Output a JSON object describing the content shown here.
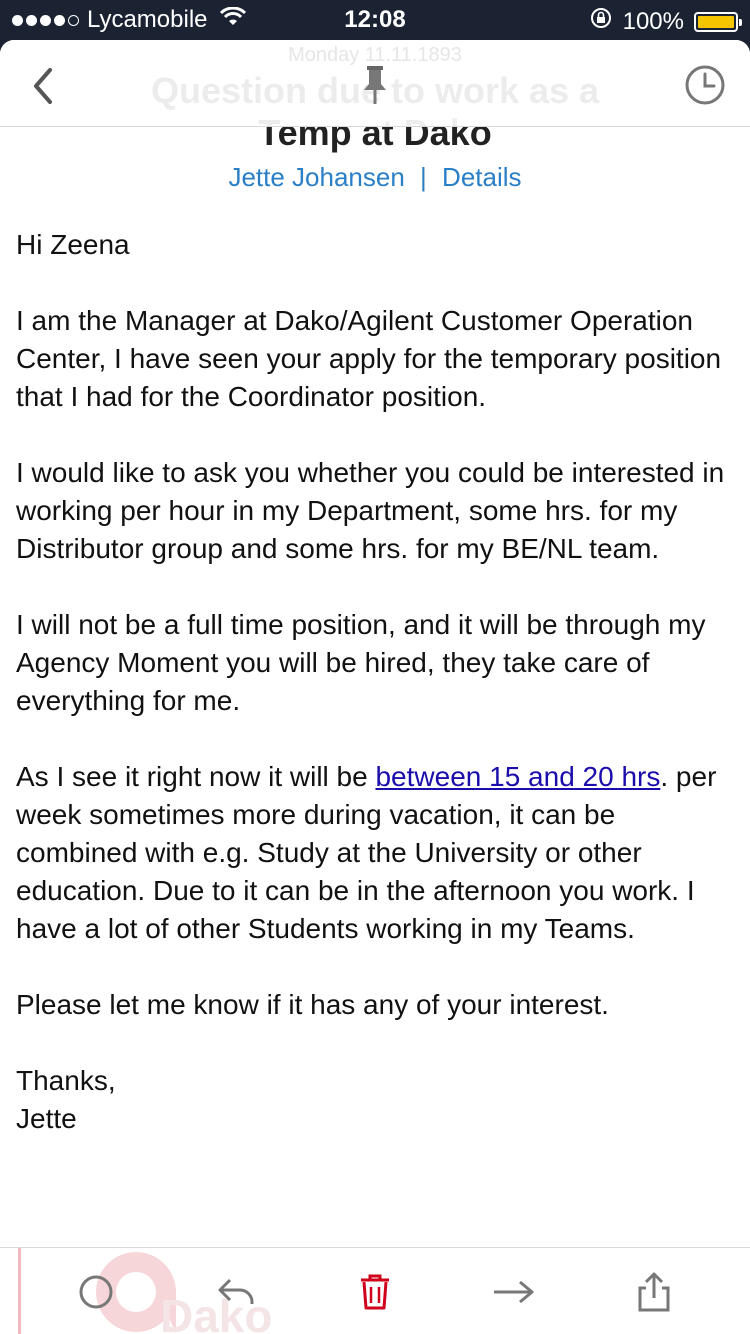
{
  "status_bar": {
    "carrier": "Lycamobile",
    "time": "12:08",
    "battery_percent": "100%",
    "signal_bars": 4,
    "battery_color": "#f5c600"
  },
  "nav": {
    "ghost_date": "Monday 11.11.1893",
    "ghost_title": "Question due to work as a",
    "icons": [
      "chevron-left-icon",
      "pin-icon",
      "clock-icon"
    ]
  },
  "email": {
    "subject": "Temp at Dako",
    "sender": "Jette Johansen",
    "separator": "|",
    "details_link": "Details",
    "greeting": "Hi Zeena",
    "paragraph_1": "I am the Manager at Dako/Agilent Customer Operation Center, I have seen your apply for the temporary position that I had for the Coordinator position.",
    "paragraph_2": "I would like to ask you whether you could be interested in working per hour in my Department, some hrs. for my Distributor group and some hrs. for my BE/NL team.",
    "paragraph_3": "I will not be a full time position, and it will be through my Agency Moment you will be hired, they take care of everything for me.",
    "paragraph_4_before": "As I see it right now it will be ",
    "paragraph_4_link": "between 15 and 20 hrs",
    "paragraph_4_after": ". per week sometimes more during vacation, it can be combined with e.g. Study at the University or other education. Due to it can be in the afternoon you work. I have a lot of other Students working in my Teams.",
    "paragraph_5": "Please let me know if it has any of your interest.",
    "closing": "Thanks,",
    "signature": "Jette"
  },
  "toolbar": {
    "watermark_text": "Dako",
    "icons": [
      "circle-icon",
      "reply-icon",
      "trash-icon",
      "forward-icon",
      "share-icon"
    ],
    "accent_color": "#d0021b"
  }
}
